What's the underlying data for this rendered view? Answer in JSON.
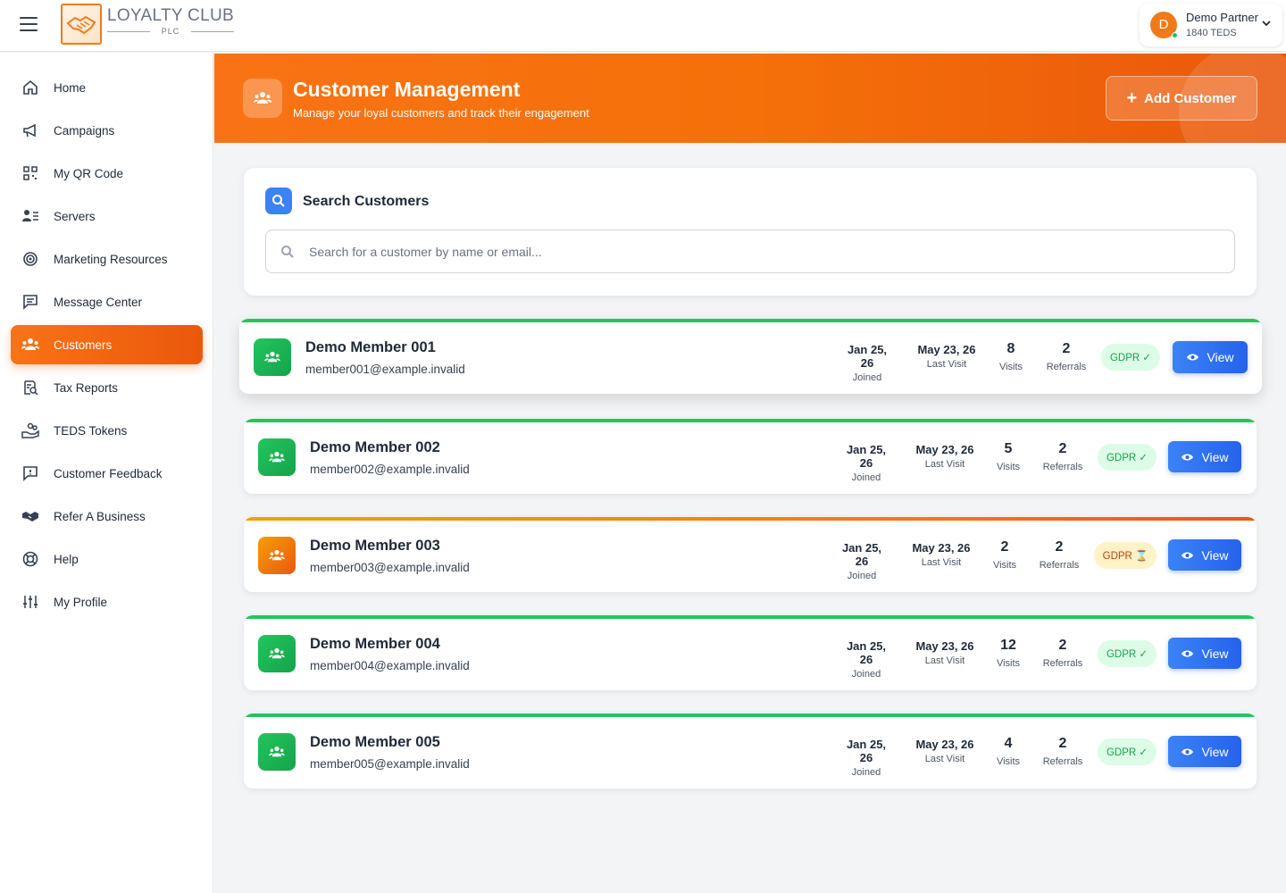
{
  "header": {
    "logo_title": "LOYALTY CLUB",
    "logo_sub": "PLC",
    "user": {
      "initial": "D",
      "name": "Demo Partner",
      "tokens": "1840 TEDS"
    }
  },
  "sidebar": {
    "items": [
      {
        "label": "Home",
        "icon": "home-icon"
      },
      {
        "label": "Campaigns",
        "icon": "megaphone-icon"
      },
      {
        "label": "My QR Code",
        "icon": "qr-code-icon"
      },
      {
        "label": "Servers",
        "icon": "servers-icon"
      },
      {
        "label": "Marketing Resources",
        "icon": "target-icon"
      },
      {
        "label": "Message Center",
        "icon": "message-icon"
      },
      {
        "label": "Customers",
        "icon": "users-icon",
        "active": true
      },
      {
        "label": "Tax Reports",
        "icon": "tax-report-icon"
      },
      {
        "label": "TEDS Tokens",
        "icon": "tokens-icon"
      },
      {
        "label": "Customer Feedback",
        "icon": "feedback-icon"
      },
      {
        "label": "Refer A Business",
        "icon": "handshake-icon"
      },
      {
        "label": "Help",
        "icon": "lifebuoy-icon"
      },
      {
        "label": "My Profile",
        "icon": "sliders-icon"
      }
    ]
  },
  "banner": {
    "title": "Customer Management",
    "subtitle": "Manage your loyal customers and track their engagement",
    "add_button": "Add Customer"
  },
  "search": {
    "title": "Search Customers",
    "placeholder": "Search for a customer by name or email..."
  },
  "customers": [
    {
      "name": "Demo Member 001",
      "email": "member001@example.invalid",
      "joined": "Jan 25, 26",
      "joined_label": "Joined",
      "last_visit": "May 23, 26",
      "last_visit_label": "Last Visit",
      "visits": "8",
      "visits_label": "Visits",
      "referrals": "2",
      "referrals_label": "Referrals",
      "gdpr": "GDPR ✓",
      "gdpr_status": "ok",
      "view": "View"
    },
    {
      "name": "Demo Member 002",
      "email": "member002@example.invalid",
      "joined": "Jan 25, 26",
      "joined_label": "Joined",
      "last_visit": "May 23, 26",
      "last_visit_label": "Last Visit",
      "visits": "5",
      "visits_label": "Visits",
      "referrals": "2",
      "referrals_label": "Referrals",
      "gdpr": "GDPR ✓",
      "gdpr_status": "ok",
      "view": "View"
    },
    {
      "name": "Demo Member 003",
      "email": "member003@example.invalid",
      "joined": "Jan 25, 26",
      "joined_label": "Joined",
      "last_visit": "May 23, 26",
      "last_visit_label": "Last Visit",
      "visits": "2",
      "visits_label": "Visits",
      "referrals": "2",
      "referrals_label": "Referrals",
      "gdpr": "GDPR ⌛",
      "gdpr_status": "pending",
      "view": "View"
    },
    {
      "name": "Demo Member 004",
      "email": "member004@example.invalid",
      "joined": "Jan 25, 26",
      "joined_label": "Joined",
      "last_visit": "May 23, 26",
      "last_visit_label": "Last Visit",
      "visits": "12",
      "visits_label": "Visits",
      "referrals": "2",
      "referrals_label": "Referrals",
      "gdpr": "GDPR ✓",
      "gdpr_status": "ok",
      "view": "View"
    },
    {
      "name": "Demo Member 005",
      "email": "member005@example.invalid",
      "joined": "Jan 25, 26",
      "joined_label": "Joined",
      "last_visit": "May 23, 26",
      "last_visit_label": "Last Visit",
      "visits": "4",
      "visits_label": "Visits",
      "referrals": "2",
      "referrals_label": "Referrals",
      "gdpr": "GDPR ✓",
      "gdpr_status": "ok",
      "view": "View"
    }
  ],
  "colors": {
    "accent": "#f97316",
    "accent_dark": "#ea580c",
    "success": "#22c55e",
    "primary": "#3b82f6"
  }
}
